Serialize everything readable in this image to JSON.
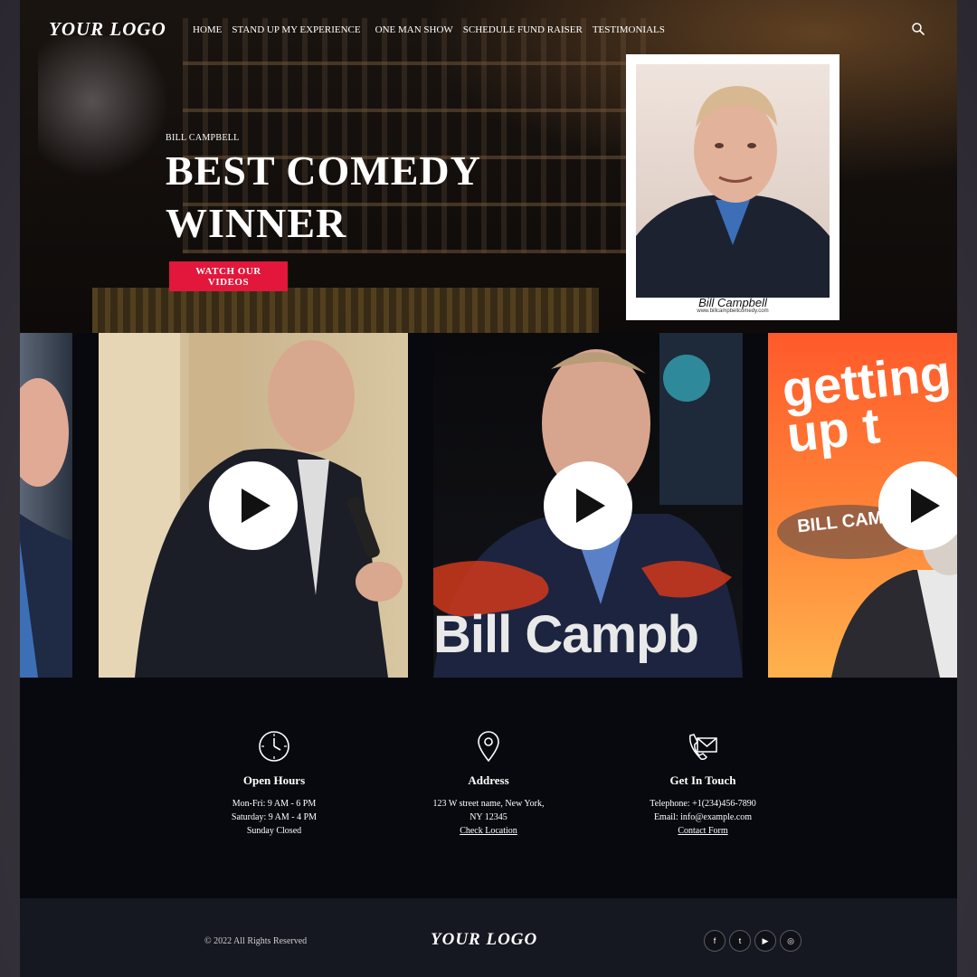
{
  "header": {
    "logo": "YOUR LOGO",
    "nav": [
      {
        "label": "HOME"
      },
      {
        "label": "STAND UP MY EXPERIENCE"
      },
      {
        "label": "ONE MAN SHOW"
      },
      {
        "label": "SCHEDULE FUND RAISER"
      },
      {
        "label": "TESTIMONIALS"
      }
    ],
    "search_icon": "search-icon"
  },
  "hero": {
    "eyebrow": "BILL CAMPBELL",
    "title_line1": "BEST COMEDY",
    "title_line2": "WINNER",
    "cta_label": "WATCH OUR VIDEOS",
    "accent_color": "#e2173b",
    "portrait_caption": "Bill Campbell",
    "portrait_url": "www.billcampbellcomedy.com"
  },
  "videos": {
    "items": [
      {
        "overlay_text": ""
      },
      {
        "overlay_text": ""
      },
      {
        "overlay_text": "Bill Campb"
      },
      {
        "overlay_text": "getting up t",
        "subtitle": "BILL CAMPBELL"
      }
    ],
    "play_icon": "play-icon"
  },
  "info": {
    "open_hours": {
      "icon": "clock-icon",
      "title": "Open Hours",
      "lines": [
        "Mon-Fri: 9 AM - 6 PM",
        "Saturday: 9 AM - 4 PM",
        "Sunday Closed"
      ]
    },
    "address": {
      "icon": "location-pin-icon",
      "title": "Address",
      "lines": [
        "123 W street name, New York,",
        "NY 12345"
      ],
      "link": "Check Location"
    },
    "contact": {
      "icon": "phone-mail-icon",
      "title": "Get In Touch",
      "lines": [
        "Telephone: +1(234)456-7890",
        "Email: info@example.com"
      ],
      "link": "Contact Form"
    }
  },
  "footer": {
    "copyright": "© 2022 All Rights Reserved",
    "logo": "YOUR LOGO",
    "socials": [
      {
        "icon": "facebook-icon",
        "glyph": "f"
      },
      {
        "icon": "twitter-icon",
        "glyph": "t"
      },
      {
        "icon": "youtube-icon",
        "glyph": "▶"
      },
      {
        "icon": "instagram-icon",
        "glyph": "◎"
      }
    ]
  }
}
